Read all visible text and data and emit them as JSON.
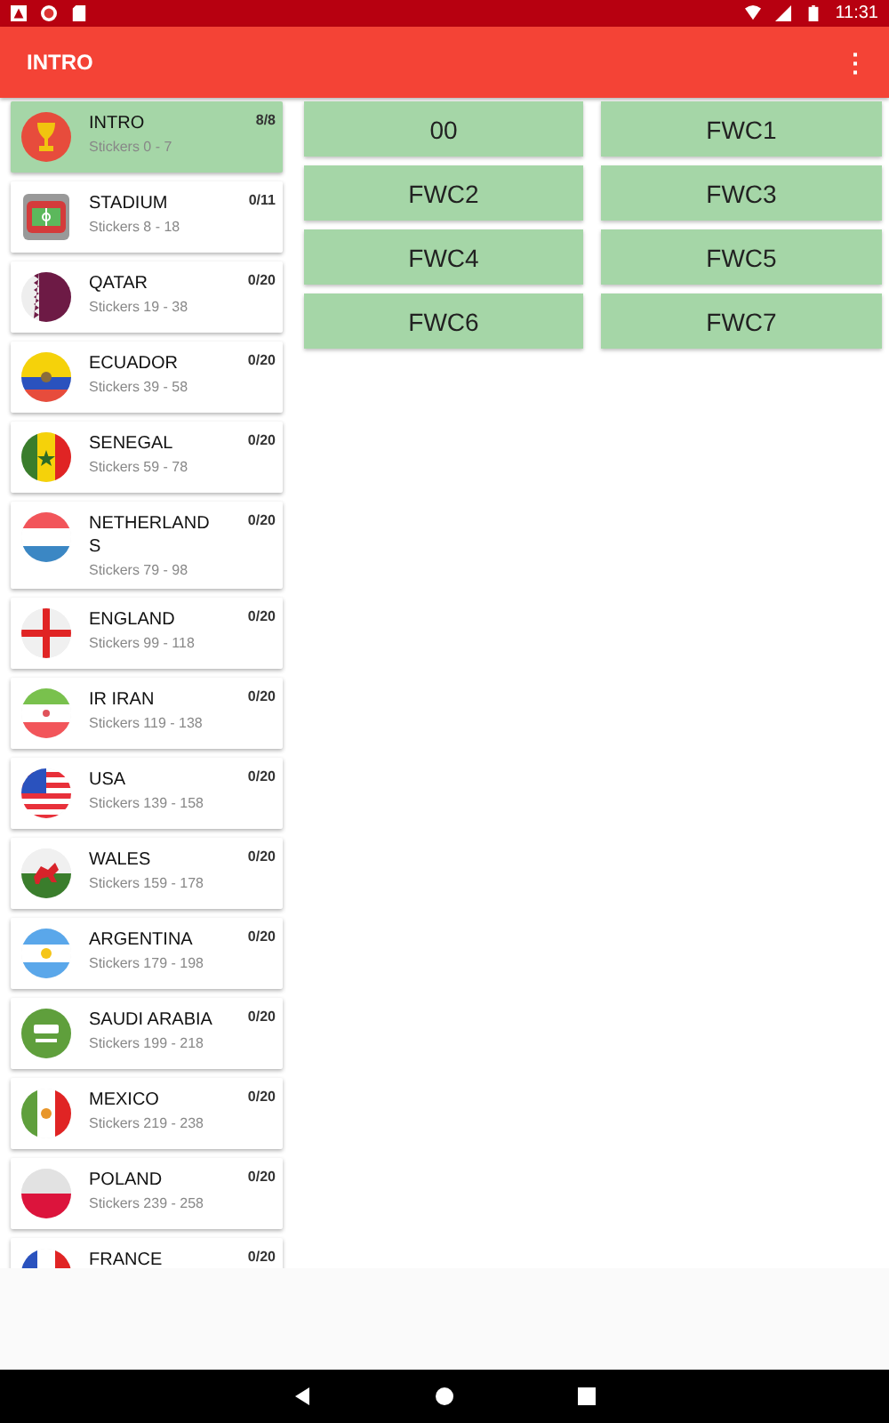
{
  "status_bar": {
    "time": "11:31"
  },
  "app_bar": {
    "title": "INTRO",
    "menu": "⋮"
  },
  "sections": [
    {
      "name": "INTRO",
      "range": "Stickers 0 - 7",
      "count": "8/8",
      "selected": true
    },
    {
      "name": "STADIUM",
      "range": "Stickers 8 - 18",
      "count": "0/11",
      "selected": false
    },
    {
      "name": "QATAR",
      "range": "Stickers 19 - 38",
      "count": "0/20",
      "selected": false
    },
    {
      "name": "ECUADOR",
      "range": "Stickers 39 - 58",
      "count": "0/20",
      "selected": false
    },
    {
      "name": "SENEGAL",
      "range": "Stickers 59 - 78",
      "count": "0/20",
      "selected": false
    },
    {
      "name": "NETHERLANDS",
      "range": "Stickers 79 - 98",
      "count": "0/20",
      "selected": false
    },
    {
      "name": "ENGLAND",
      "range": "Stickers 99 - 118",
      "count": "0/20",
      "selected": false
    },
    {
      "name": "IR IRAN",
      "range": "Stickers 119 - 138",
      "count": "0/20",
      "selected": false
    },
    {
      "name": "USA",
      "range": "Stickers 139 - 158",
      "count": "0/20",
      "selected": false
    },
    {
      "name": "WALES",
      "range": "Stickers 159 - 178",
      "count": "0/20",
      "selected": false
    },
    {
      "name": "ARGENTINA",
      "range": "Stickers 179 - 198",
      "count": "0/20",
      "selected": false
    },
    {
      "name": "SAUDI ARABIA",
      "range": "Stickers 199 - 218",
      "count": "0/20",
      "selected": false
    },
    {
      "name": "MEXICO",
      "range": "Stickers 219 - 238",
      "count": "0/20",
      "selected": false
    },
    {
      "name": "POLAND",
      "range": "Stickers 239 - 258",
      "count": "0/20",
      "selected": false
    },
    {
      "name": "FRANCE",
      "count": "0/20",
      "selected": false
    }
  ],
  "stickers": [
    "00",
    "FWC1",
    "FWC2",
    "FWC3",
    "FWC4",
    "FWC5",
    "FWC6",
    "FWC7"
  ]
}
